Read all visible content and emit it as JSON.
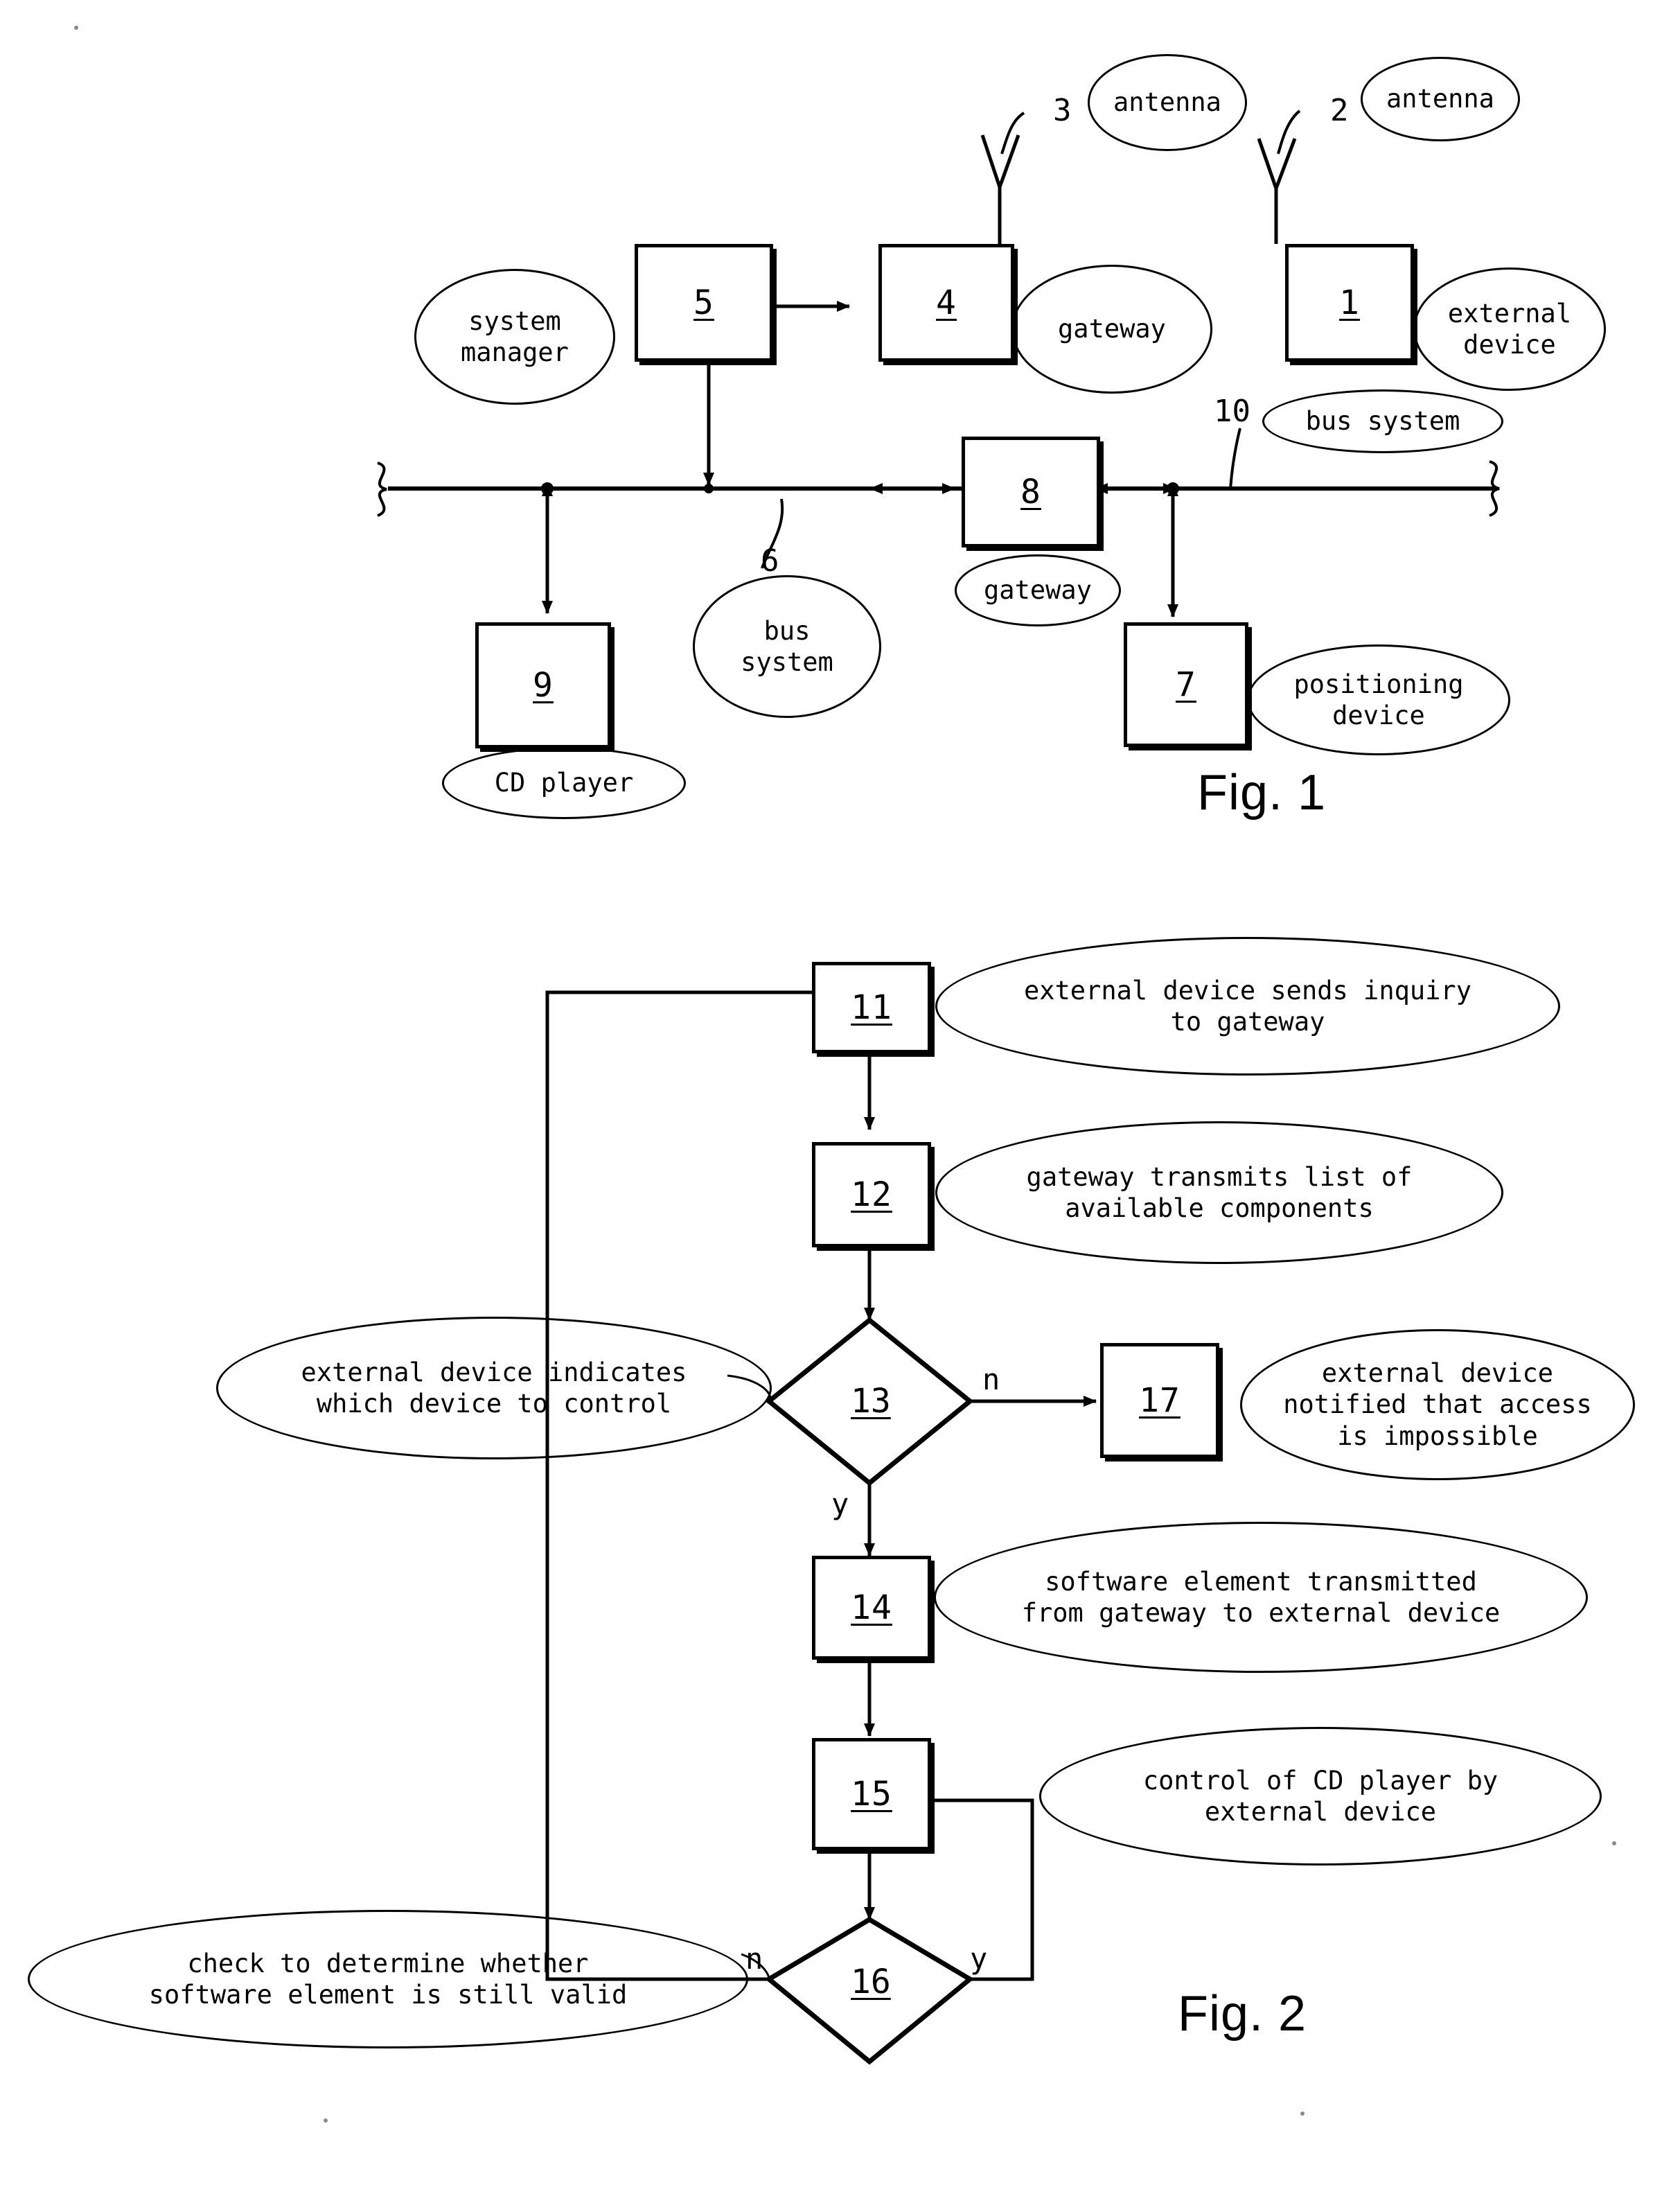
{
  "figure1": {
    "caption": "Fig. 1",
    "blocks": [
      {
        "id": "5",
        "label": "system\nmanager"
      },
      {
        "id": "4",
        "label": "gateway"
      },
      {
        "id": "1",
        "label": "external\ndevice"
      },
      {
        "id": "8",
        "label": "gateway"
      },
      {
        "id": "9",
        "label": "CD player"
      },
      {
        "id": "7",
        "label": "positioning\ndevice"
      }
    ],
    "antennas": [
      {
        "ref": "3",
        "label": "antenna"
      },
      {
        "ref": "2",
        "label": "antenna"
      }
    ],
    "bus_labels": [
      {
        "ref": "10",
        "label": "bus system"
      },
      {
        "ref": "6",
        "label": "bus\nsystem"
      }
    ]
  },
  "figure2": {
    "caption": "Fig. 2",
    "steps": [
      {
        "id": "11",
        "shape": "process",
        "label": "external device sends inquiry\nto gateway"
      },
      {
        "id": "12",
        "shape": "process",
        "label": "gateway transmits list of\navailable components"
      },
      {
        "id": "13",
        "shape": "decision",
        "label": "external device indicates\nwhich device to control"
      },
      {
        "id": "17",
        "shape": "process",
        "label": "external device\nnotified that access\nis impossible"
      },
      {
        "id": "14",
        "shape": "process",
        "label": "software element transmitted\nfrom gateway to external device"
      },
      {
        "id": "15",
        "shape": "process",
        "label": "control of CD player by\nexternal device"
      },
      {
        "id": "16",
        "shape": "decision",
        "label": "check to determine whether\nsoftware element is still valid"
      }
    ],
    "branch_labels": {
      "d13_no": "n",
      "d13_yes": "y",
      "d16_no": "n",
      "d16_yes": "y"
    }
  }
}
